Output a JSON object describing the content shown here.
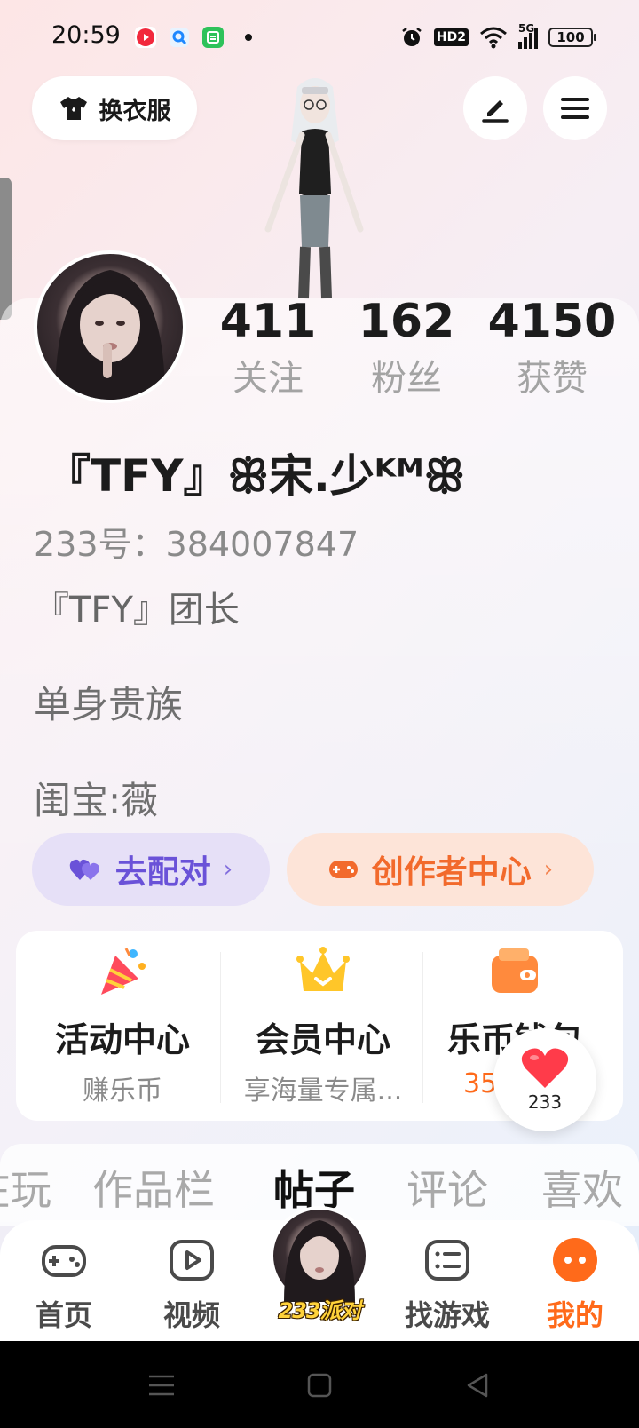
{
  "status_bar": {
    "time": "20:59",
    "hd_label": "HD2",
    "network_label": "5G",
    "battery": "100",
    "icons": [
      "red-app-icon",
      "blue-app-icon",
      "green-app-icon",
      "notification-dot-icon",
      "alarm-icon",
      "wifi-icon",
      "signal-icon",
      "battery-icon"
    ]
  },
  "header": {
    "outfit_label": "换衣服",
    "edit_icon": "edit-icon",
    "menu_icon": "menu-icon"
  },
  "profile": {
    "stats": [
      {
        "value": "411",
        "label": "关注"
      },
      {
        "value": "162",
        "label": "粉丝"
      },
      {
        "value": "4150",
        "label": "获赞"
      }
    ],
    "username": "『TFY』ꕥ宋.少ᴷᴹꕥ",
    "id_line": "233号：384007847",
    "bio": [
      "『TFY』团长",
      "单身贵族",
      "闺宝:薇"
    ]
  },
  "actions": {
    "match_label": "去配对",
    "creator_label": "创作者中心"
  },
  "features": [
    {
      "title": "活动中心",
      "sub": "赚乐币",
      "icon": "party-popper-icon"
    },
    {
      "title": "会员中心",
      "sub": "享海量专属...",
      "icon": "crown-icon"
    },
    {
      "title": "乐币钱包",
      "sub": "35",
      "icon": "wallet-icon"
    }
  ],
  "float_heart": {
    "count": "233"
  },
  "tabs": [
    "在玩",
    "作品栏",
    "帖子",
    "评论",
    "喜欢"
  ],
  "active_tab": "帖子",
  "bottom_nav": {
    "items": [
      {
        "label": "首页",
        "icon": "gamepad-icon"
      },
      {
        "label": "视频",
        "icon": "play-icon"
      },
      {
        "label": "找游戏",
        "icon": "list-icon"
      },
      {
        "label": "我的",
        "icon": "profile-dots-icon"
      }
    ],
    "center_badge": "233派对"
  },
  "colors": {
    "accent_orange": "#ff6a1a",
    "match_purple": "#6a52d8",
    "creator_orange": "#f26a2c",
    "heart_red": "#ff3b4a"
  }
}
